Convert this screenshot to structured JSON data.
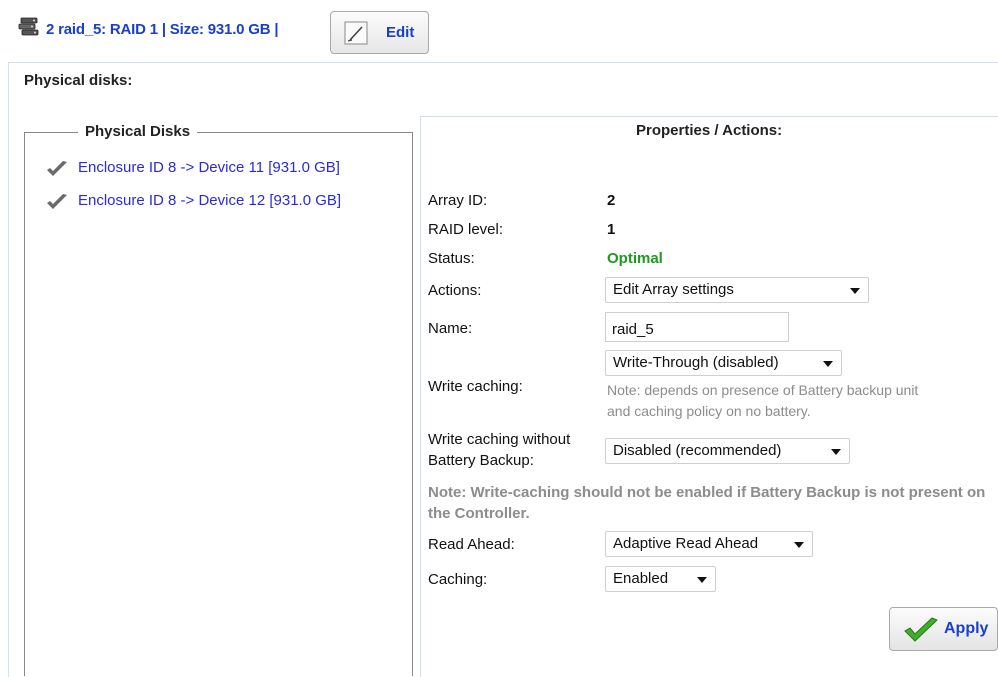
{
  "header": {
    "icon": "raid-array-icon",
    "title_part1": "2 raid_5: RAID ",
    "title_raid": "1",
    "title_part2": " | Size: 931.0 GB |",
    "edit_label": "Edit",
    "edit_icon": "pencil-icon"
  },
  "section": {
    "heading": "Physical disks:"
  },
  "disks": {
    "legend": "Physical Disks",
    "items": [
      {
        "label": "Enclosure ID 8 -> Device 11 [931.0 GB]",
        "icon": "checkmark-icon"
      },
      {
        "label": "Enclosure ID 8 -> Device 12 [931.0 GB]",
        "icon": "checkmark-icon"
      }
    ]
  },
  "properties": {
    "title": "Properties / Actions:",
    "array_id_label": "Array ID:",
    "array_id": "2",
    "raid_level_label": "RAID level:",
    "raid_level": "1",
    "status_label": "Status:",
    "status": "Optimal",
    "status_color": "#1e9a1e",
    "actions_label": "Actions:",
    "actions_selected": "Edit Array settings",
    "name_label": "Name:",
    "name_value": "raid_5",
    "write_caching_label": "Write caching:",
    "write_caching_selected": "Write-Through (disabled)",
    "write_caching_note_line1": "Note: depends on presence of Battery backup unit",
    "write_caching_note_line2": "and caching policy on no battery.",
    "wc_no_bbu_label_line1": "Write caching without",
    "wc_no_bbu_label_line2": "Battery Backup:",
    "wc_no_bbu_selected": "Disabled (recommended)",
    "bbu_note": "Note: Write-caching should not be enabled if Battery Backup is not present on the Controller.",
    "read_ahead_label": "Read Ahead:",
    "read_ahead_selected": "Adaptive Read Ahead",
    "caching_label": "Caching:",
    "caching_selected": "Enabled",
    "apply_label": "Apply",
    "apply_icon": "checkmark-icon"
  },
  "colors": {
    "link": "#1a3fcc",
    "disk_link": "#2a2ad8",
    "note": "#8c8c8c"
  }
}
